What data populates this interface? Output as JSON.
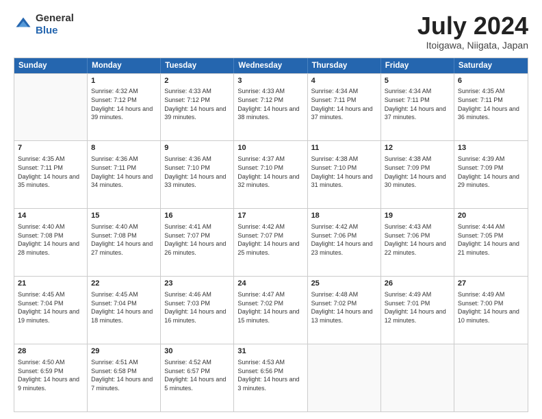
{
  "header": {
    "logo": {
      "general": "General",
      "blue": "Blue"
    },
    "title": "July 2024",
    "location": "Itoigawa, Niigata, Japan"
  },
  "days_of_week": [
    "Sunday",
    "Monday",
    "Tuesday",
    "Wednesday",
    "Thursday",
    "Friday",
    "Saturday"
  ],
  "weeks": [
    [
      {
        "day": null,
        "sunrise": null,
        "sunset": null,
        "daylight": null
      },
      {
        "day": "1",
        "sunrise": "Sunrise: 4:32 AM",
        "sunset": "Sunset: 7:12 PM",
        "daylight": "Daylight: 14 hours and 39 minutes."
      },
      {
        "day": "2",
        "sunrise": "Sunrise: 4:33 AM",
        "sunset": "Sunset: 7:12 PM",
        "daylight": "Daylight: 14 hours and 39 minutes."
      },
      {
        "day": "3",
        "sunrise": "Sunrise: 4:33 AM",
        "sunset": "Sunset: 7:12 PM",
        "daylight": "Daylight: 14 hours and 38 minutes."
      },
      {
        "day": "4",
        "sunrise": "Sunrise: 4:34 AM",
        "sunset": "Sunset: 7:11 PM",
        "daylight": "Daylight: 14 hours and 37 minutes."
      },
      {
        "day": "5",
        "sunrise": "Sunrise: 4:34 AM",
        "sunset": "Sunset: 7:11 PM",
        "daylight": "Daylight: 14 hours and 37 minutes."
      },
      {
        "day": "6",
        "sunrise": "Sunrise: 4:35 AM",
        "sunset": "Sunset: 7:11 PM",
        "daylight": "Daylight: 14 hours and 36 minutes."
      }
    ],
    [
      {
        "day": "7",
        "sunrise": "Sunrise: 4:35 AM",
        "sunset": "Sunset: 7:11 PM",
        "daylight": "Daylight: 14 hours and 35 minutes."
      },
      {
        "day": "8",
        "sunrise": "Sunrise: 4:36 AM",
        "sunset": "Sunset: 7:11 PM",
        "daylight": "Daylight: 14 hours and 34 minutes."
      },
      {
        "day": "9",
        "sunrise": "Sunrise: 4:36 AM",
        "sunset": "Sunset: 7:10 PM",
        "daylight": "Daylight: 14 hours and 33 minutes."
      },
      {
        "day": "10",
        "sunrise": "Sunrise: 4:37 AM",
        "sunset": "Sunset: 7:10 PM",
        "daylight": "Daylight: 14 hours and 32 minutes."
      },
      {
        "day": "11",
        "sunrise": "Sunrise: 4:38 AM",
        "sunset": "Sunset: 7:10 PM",
        "daylight": "Daylight: 14 hours and 31 minutes."
      },
      {
        "day": "12",
        "sunrise": "Sunrise: 4:38 AM",
        "sunset": "Sunset: 7:09 PM",
        "daylight": "Daylight: 14 hours and 30 minutes."
      },
      {
        "day": "13",
        "sunrise": "Sunrise: 4:39 AM",
        "sunset": "Sunset: 7:09 PM",
        "daylight": "Daylight: 14 hours and 29 minutes."
      }
    ],
    [
      {
        "day": "14",
        "sunrise": "Sunrise: 4:40 AM",
        "sunset": "Sunset: 7:08 PM",
        "daylight": "Daylight: 14 hours and 28 minutes."
      },
      {
        "day": "15",
        "sunrise": "Sunrise: 4:40 AM",
        "sunset": "Sunset: 7:08 PM",
        "daylight": "Daylight: 14 hours and 27 minutes."
      },
      {
        "day": "16",
        "sunrise": "Sunrise: 4:41 AM",
        "sunset": "Sunset: 7:07 PM",
        "daylight": "Daylight: 14 hours and 26 minutes."
      },
      {
        "day": "17",
        "sunrise": "Sunrise: 4:42 AM",
        "sunset": "Sunset: 7:07 PM",
        "daylight": "Daylight: 14 hours and 25 minutes."
      },
      {
        "day": "18",
        "sunrise": "Sunrise: 4:42 AM",
        "sunset": "Sunset: 7:06 PM",
        "daylight": "Daylight: 14 hours and 23 minutes."
      },
      {
        "day": "19",
        "sunrise": "Sunrise: 4:43 AM",
        "sunset": "Sunset: 7:06 PM",
        "daylight": "Daylight: 14 hours and 22 minutes."
      },
      {
        "day": "20",
        "sunrise": "Sunrise: 4:44 AM",
        "sunset": "Sunset: 7:05 PM",
        "daylight": "Daylight: 14 hours and 21 minutes."
      }
    ],
    [
      {
        "day": "21",
        "sunrise": "Sunrise: 4:45 AM",
        "sunset": "Sunset: 7:04 PM",
        "daylight": "Daylight: 14 hours and 19 minutes."
      },
      {
        "day": "22",
        "sunrise": "Sunrise: 4:45 AM",
        "sunset": "Sunset: 7:04 PM",
        "daylight": "Daylight: 14 hours and 18 minutes."
      },
      {
        "day": "23",
        "sunrise": "Sunrise: 4:46 AM",
        "sunset": "Sunset: 7:03 PM",
        "daylight": "Daylight: 14 hours and 16 minutes."
      },
      {
        "day": "24",
        "sunrise": "Sunrise: 4:47 AM",
        "sunset": "Sunset: 7:02 PM",
        "daylight": "Daylight: 14 hours and 15 minutes."
      },
      {
        "day": "25",
        "sunrise": "Sunrise: 4:48 AM",
        "sunset": "Sunset: 7:02 PM",
        "daylight": "Daylight: 14 hours and 13 minutes."
      },
      {
        "day": "26",
        "sunrise": "Sunrise: 4:49 AM",
        "sunset": "Sunset: 7:01 PM",
        "daylight": "Daylight: 14 hours and 12 minutes."
      },
      {
        "day": "27",
        "sunrise": "Sunrise: 4:49 AM",
        "sunset": "Sunset: 7:00 PM",
        "daylight": "Daylight: 14 hours and 10 minutes."
      }
    ],
    [
      {
        "day": "28",
        "sunrise": "Sunrise: 4:50 AM",
        "sunset": "Sunset: 6:59 PM",
        "daylight": "Daylight: 14 hours and 9 minutes."
      },
      {
        "day": "29",
        "sunrise": "Sunrise: 4:51 AM",
        "sunset": "Sunset: 6:58 PM",
        "daylight": "Daylight: 14 hours and 7 minutes."
      },
      {
        "day": "30",
        "sunrise": "Sunrise: 4:52 AM",
        "sunset": "Sunset: 6:57 PM",
        "daylight": "Daylight: 14 hours and 5 minutes."
      },
      {
        "day": "31",
        "sunrise": "Sunrise: 4:53 AM",
        "sunset": "Sunset: 6:56 PM",
        "daylight": "Daylight: 14 hours and 3 minutes."
      },
      {
        "day": null,
        "sunrise": null,
        "sunset": null,
        "daylight": null
      },
      {
        "day": null,
        "sunrise": null,
        "sunset": null,
        "daylight": null
      },
      {
        "day": null,
        "sunrise": null,
        "sunset": null,
        "daylight": null
      }
    ]
  ]
}
